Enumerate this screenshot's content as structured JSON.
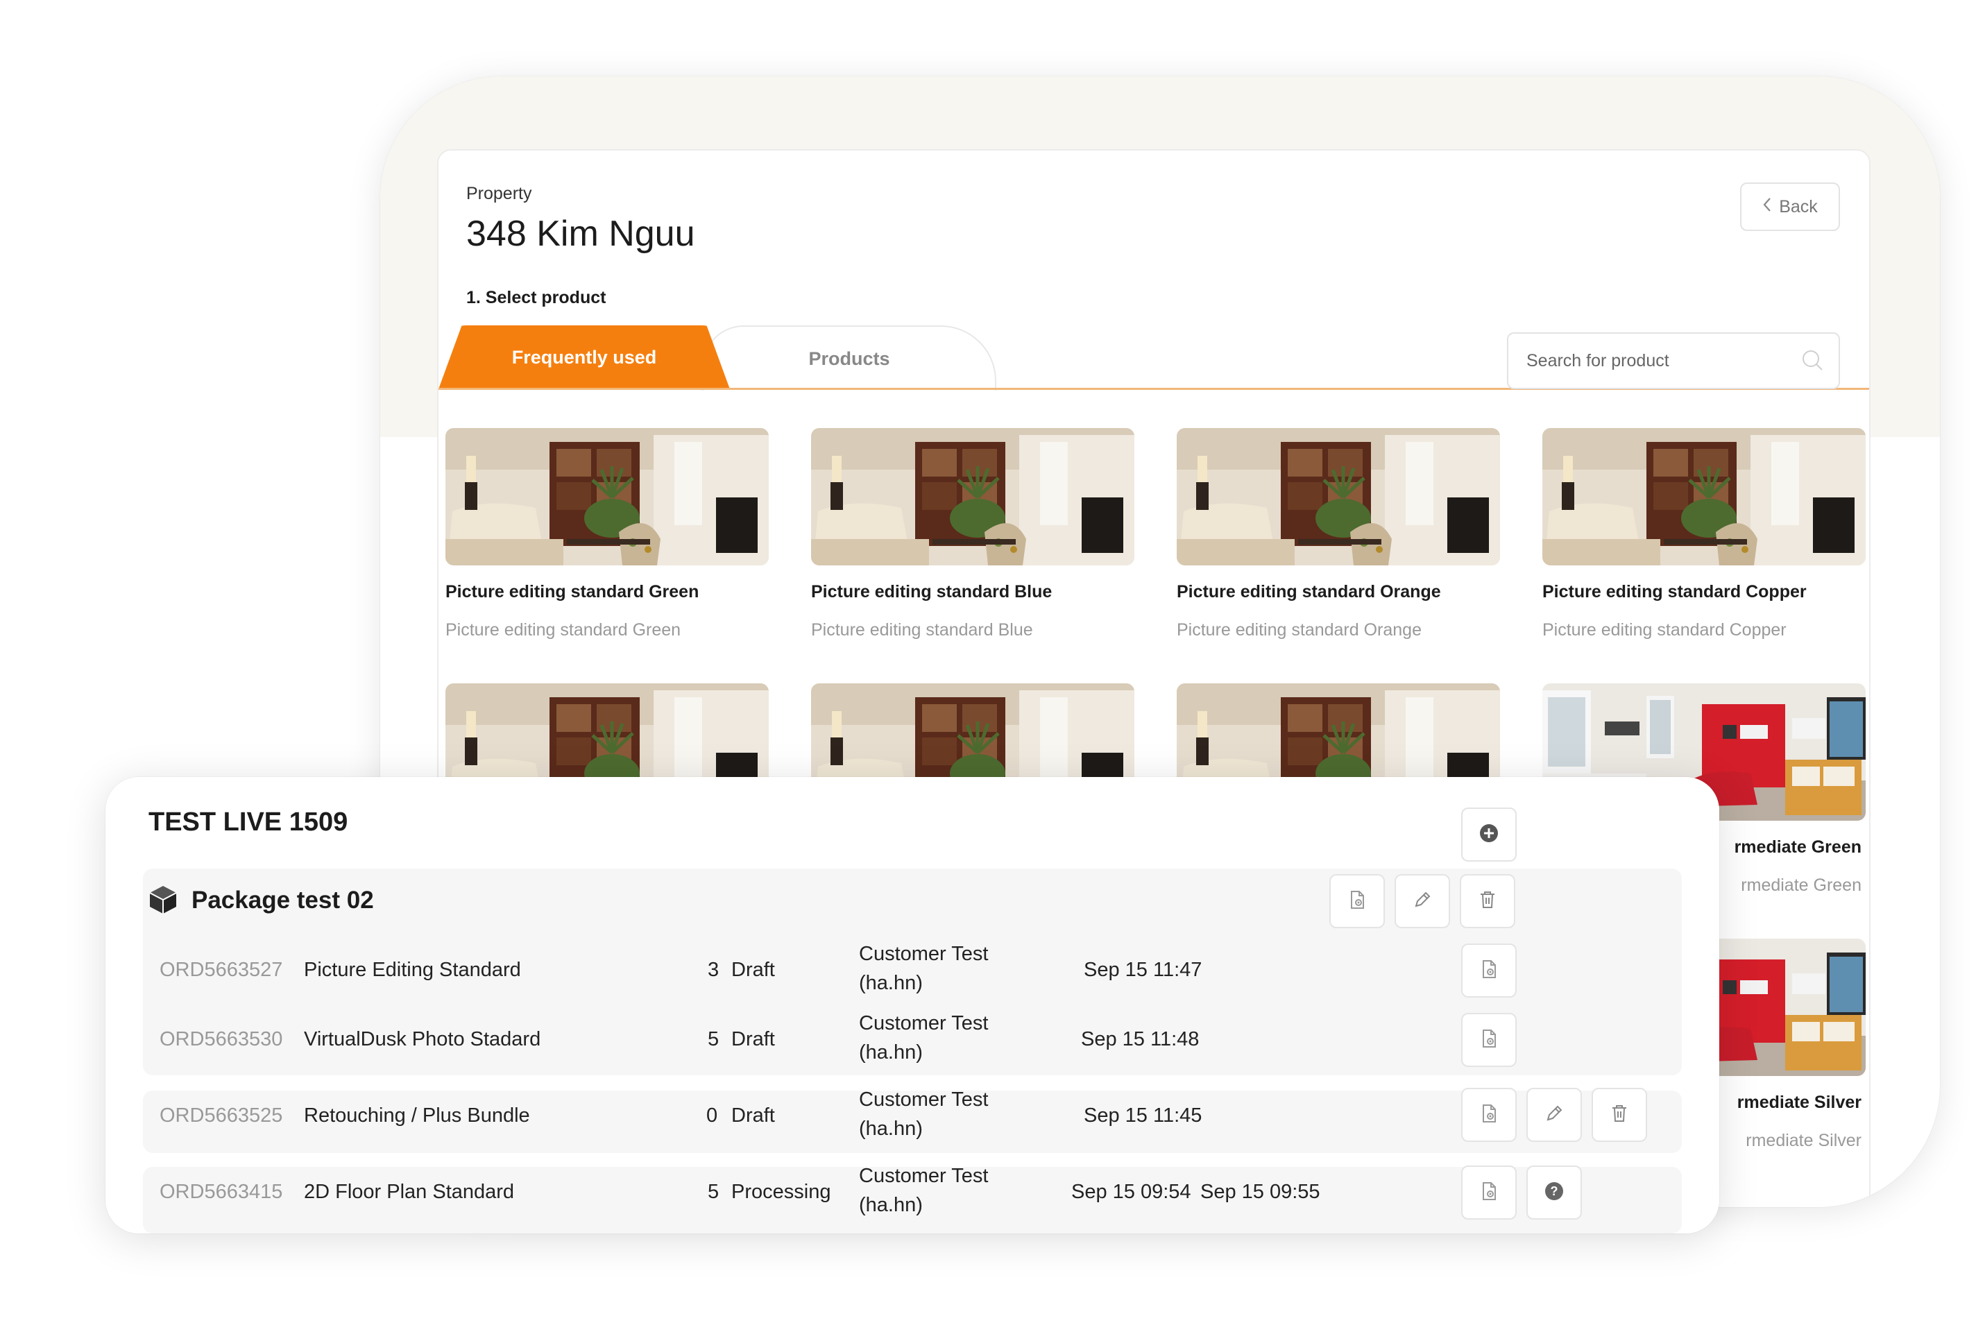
{
  "property": {
    "label": "Property",
    "name": "348 Kim Nguu",
    "back_label": "Back",
    "step_label": "1. Select product"
  },
  "tabs": [
    {
      "label": "Frequently used",
      "active": true
    },
    {
      "label": "Products",
      "active": false
    }
  ],
  "search": {
    "placeholder": "Search for product"
  },
  "products": [
    {
      "title": "Picture editing standard Green",
      "subtitle": "Picture editing standard Green",
      "photo": "living-room"
    },
    {
      "title": "Picture editing standard Blue",
      "subtitle": "Picture editing standard Blue",
      "photo": "living-room"
    },
    {
      "title": "Picture editing standard Orange",
      "subtitle": "Picture editing standard Orange",
      "photo": "living-room"
    },
    {
      "title": "Picture editing standard Copper",
      "subtitle": "Picture editing standard Copper",
      "photo": "living-room"
    },
    {
      "title": "",
      "subtitle": "",
      "photo": "living-room"
    },
    {
      "title": "",
      "subtitle": "",
      "photo": "living-room"
    },
    {
      "title": "",
      "subtitle": "",
      "photo": "living-room"
    },
    {
      "title": "rmediate Green",
      "subtitle": "rmediate Green",
      "photo": "red-sofa-room"
    },
    {
      "title": "rmediate Silver",
      "subtitle": "rmediate Silver",
      "photo": "red-sofa-room"
    }
  ],
  "order_panel": {
    "title": "TEST LIVE 1509",
    "package": {
      "name": "Package test 02",
      "icon": "box-icon"
    },
    "orders": [
      {
        "id": "ORD5663527",
        "product": "Picture Editing Standard",
        "qty": "3",
        "status": "Draft",
        "customer_line1": "Customer Test",
        "customer_line2": "(ha.hn)",
        "created": "Sep 15 11:47",
        "completed": ""
      },
      {
        "id": "ORD5663530",
        "product": "VirtualDusk Photo Stadard",
        "qty": "5",
        "status": "Draft",
        "customer_line1": "Customer Test",
        "customer_line2": "(ha.hn)",
        "created": "Sep 15 11:48",
        "completed": ""
      },
      {
        "id": "ORD5663525",
        "product": "Retouching / Plus Bundle",
        "qty": "0",
        "status": "Draft",
        "customer_line1": "Customer Test",
        "customer_line2": "(ha.hn)",
        "created": "Sep 15 11:45",
        "completed": ""
      },
      {
        "id": "ORD5663415",
        "product": "2D Floor Plan Standard",
        "qty": "5",
        "status": "Processing",
        "customer_line1": "Customer Test",
        "customer_line2": "(ha.hn)",
        "created": "Sep 15 09:54",
        "completed": "Sep 15 09:55"
      }
    ]
  },
  "colors": {
    "accent": "#f57f0e",
    "tab_underline": "#f2b77a",
    "muted_text": "#999999"
  }
}
